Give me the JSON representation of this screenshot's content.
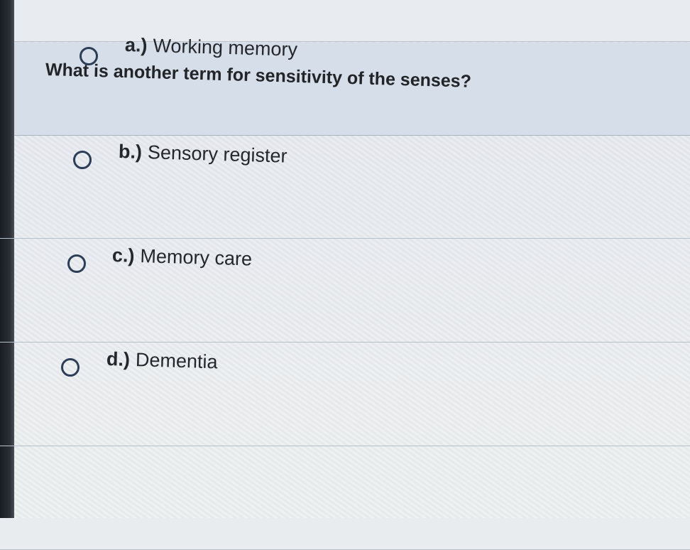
{
  "question": {
    "text": "What is another term for sensitivity of the senses?"
  },
  "options": [
    {
      "letter": "a.)",
      "text": "Working memory",
      "selected": false
    },
    {
      "letter": "b.)",
      "text": "Sensory register",
      "selected": false
    },
    {
      "letter": "c.)",
      "text": "Memory care",
      "selected": false
    },
    {
      "letter": "d.)",
      "text": "Dementia",
      "selected": false
    }
  ],
  "colors": {
    "question_panel": "#d6deea",
    "radio_border": "#2b3d57",
    "text": "#24272c"
  }
}
